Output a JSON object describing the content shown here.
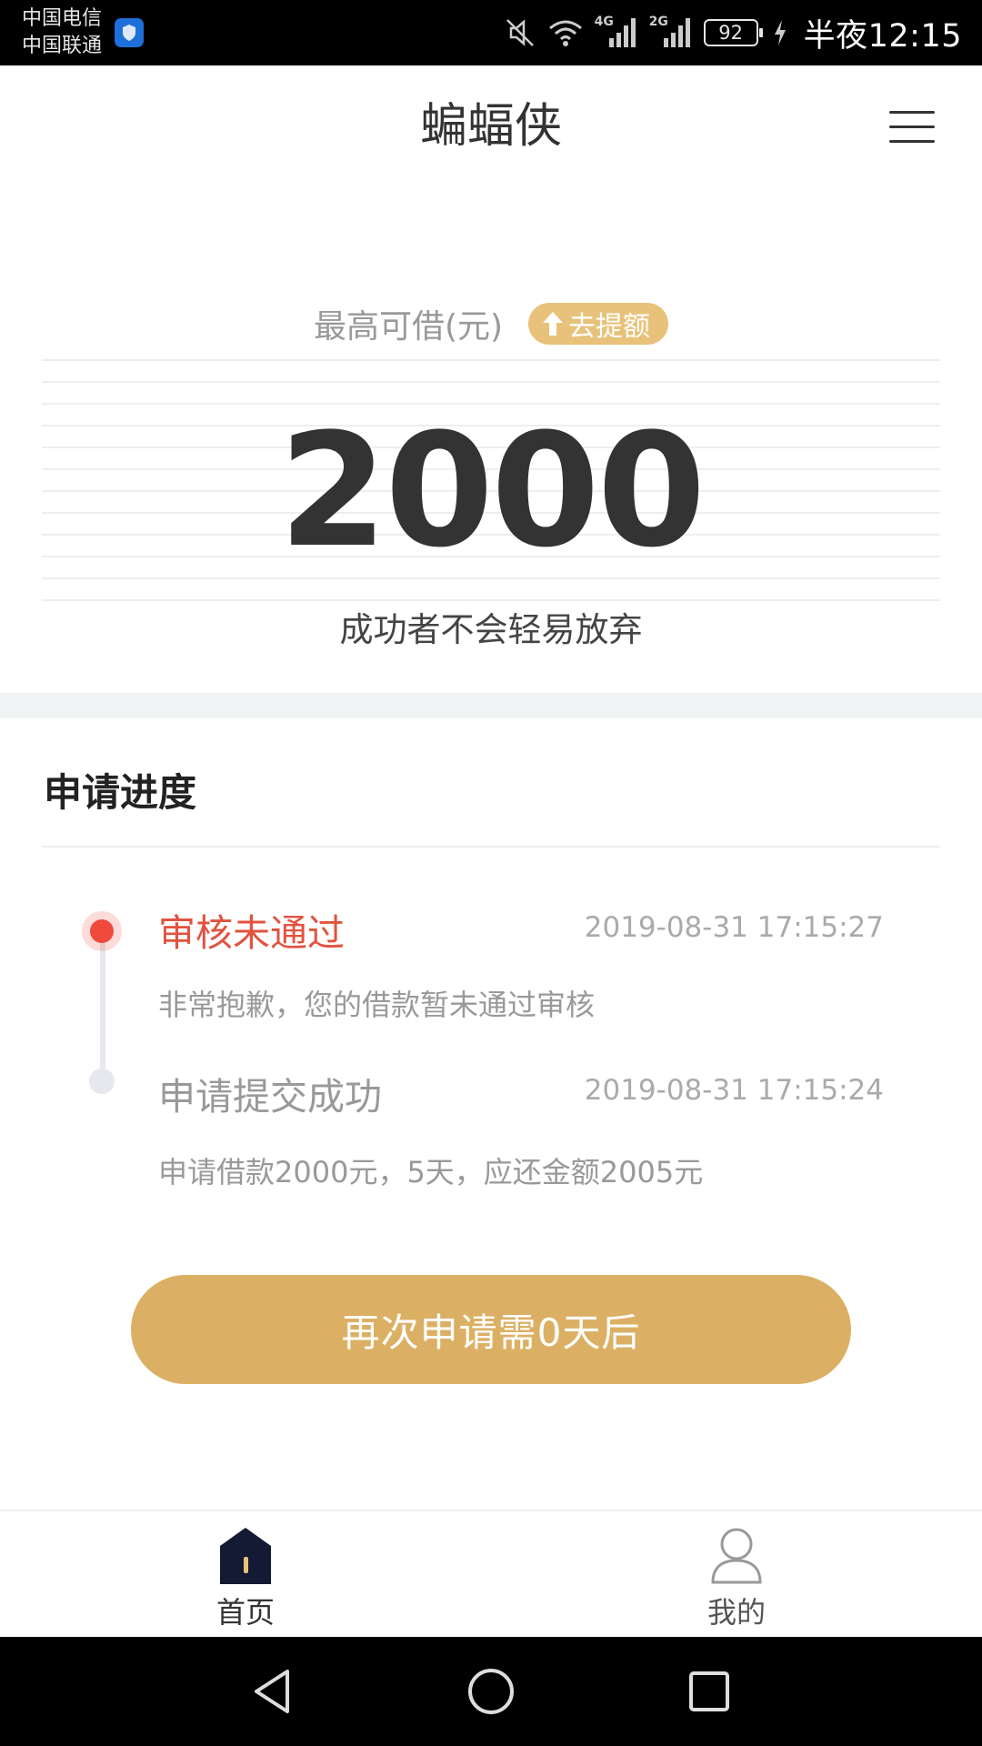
{
  "status_bar": {
    "carrier_1": "中国电信",
    "carrier_2": "中国联通",
    "network_1": "4G",
    "network_2": "2G",
    "battery": "92",
    "time": "半夜12:15"
  },
  "header": {
    "title": "蝙蝠侠",
    "menu_icon": "menu-icon"
  },
  "hero": {
    "limit_label": "最高可借(元)",
    "raise_label": "去提额",
    "amount": "2000",
    "slogan": "成功者不会轻易放弃"
  },
  "progress": {
    "title": "申请进度",
    "steps": [
      {
        "title": "审核未通过",
        "time": "2019-08-31 17:15:27",
        "desc": "非常抱歉，您的借款暂未通过审核"
      },
      {
        "title": "申请提交成功",
        "time": "2019-08-31 17:15:24",
        "desc": "申请借款2000元，5天，应还金额2005元"
      }
    ]
  },
  "action": {
    "reapply_label": "再次申请需0天后"
  },
  "tabbar": {
    "home_label": "首页",
    "mine_label": "我的"
  },
  "colors": {
    "accent_gold": "#dcb064",
    "badge_gold": "#e8c27a",
    "reject_red": "#e2533f",
    "tab_home_dark": "#141a33"
  }
}
